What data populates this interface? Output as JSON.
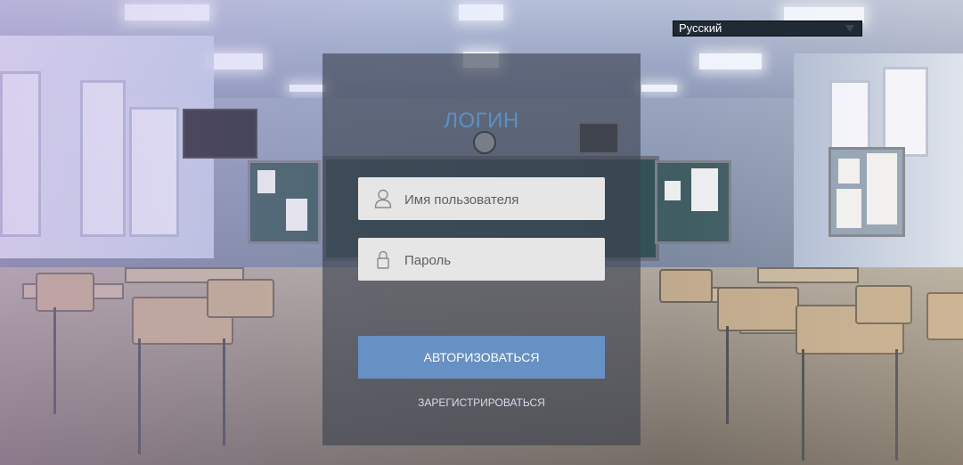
{
  "language_select": {
    "value": "Русский"
  },
  "login": {
    "title": "ЛОГИН",
    "username_placeholder": "Имя пользователя",
    "password_placeholder": "Пароль",
    "submit_label": "АВТОРИЗОВАТЬСЯ",
    "register_link": "ЗАРЕГИСТРИРОВАТЬСЯ"
  },
  "colors": {
    "accent": "#6790c5",
    "title": "#5d8fc4",
    "input_bg": "#e6e6e6",
    "panel_bg": "rgba(58,64,78,0.62)"
  },
  "icons": {
    "username": "user-icon",
    "password": "lock-icon",
    "select": "chevron-down-icon"
  }
}
